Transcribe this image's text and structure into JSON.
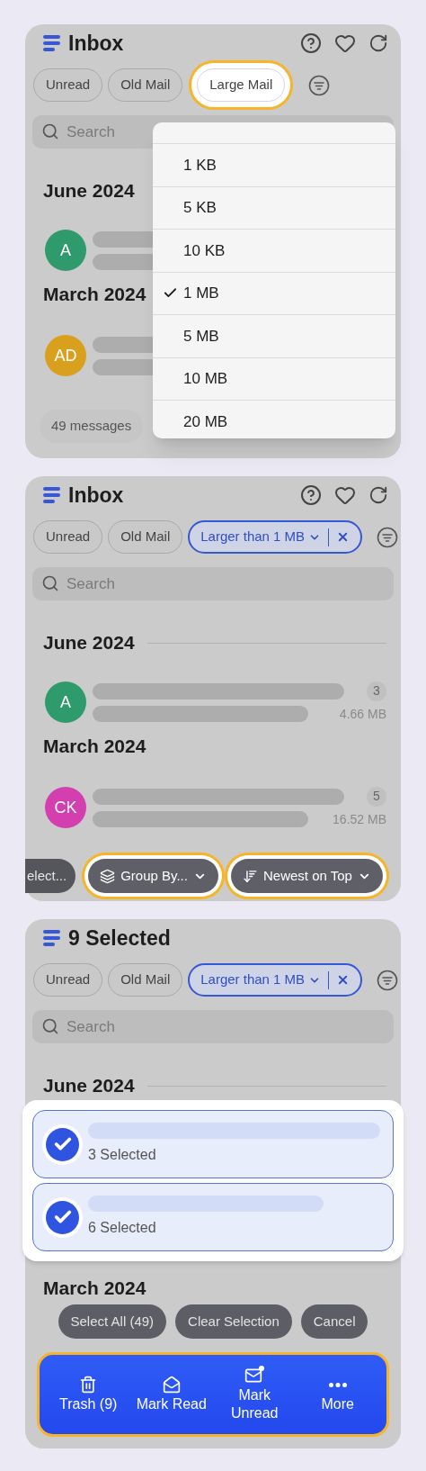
{
  "panels": [
    {
      "title": "Inbox",
      "show_actions": true,
      "filters": [
        {
          "label": "Unread",
          "kind": "chip",
          "active": false,
          "highlighted": false
        },
        {
          "label": "Old Mail",
          "kind": "chip",
          "active": false,
          "highlighted": false
        },
        {
          "label": "Large Mail",
          "kind": "chip",
          "active": false,
          "highlighted": true
        }
      ],
      "search": {
        "placeholder": "Search"
      },
      "sections": [
        {
          "heading": "June 2024",
          "rows": [
            {
              "kind": "message",
              "initials": "A",
              "color": "#2f9a6c"
            }
          ]
        },
        {
          "heading": "March 2024",
          "rows": [
            {
              "kind": "message",
              "initials": "AD",
              "color": "#d9a01e"
            }
          ]
        }
      ],
      "bottom_bar": [
        {
          "label": "49 messages",
          "kind": "count",
          "highlighted": false
        }
      ],
      "dropdown": {
        "items": [
          {
            "label": "1 KB",
            "selected": false
          },
          {
            "label": "5 KB",
            "selected": false
          },
          {
            "label": "10 KB",
            "selected": false
          },
          {
            "label": "1 MB",
            "selected": true
          },
          {
            "label": "5 MB",
            "selected": false
          },
          {
            "label": "10 MB",
            "selected": false
          },
          {
            "label": "20 MB",
            "selected": false
          }
        ]
      }
    },
    {
      "title": "Inbox",
      "show_actions": true,
      "filters": [
        {
          "label": "Unread",
          "kind": "chip",
          "active": false,
          "highlighted": false
        },
        {
          "label": "Old Mail",
          "kind": "chip",
          "active": false,
          "highlighted": false
        },
        {
          "label": "Larger than 1 MB",
          "kind": "dropdown",
          "active": true,
          "highlighted": false
        }
      ],
      "search": {
        "placeholder": "Search"
      },
      "sections": [
        {
          "heading": "June 2024",
          "divider": true,
          "rows": [
            {
              "kind": "message",
              "initials": "A",
              "color": "#2f9a6c",
              "count": "3",
              "size": "4.66 MB"
            }
          ]
        },
        {
          "heading": "March 2024",
          "divider": false,
          "rows": [
            {
              "kind": "message",
              "initials": "CK",
              "color": "#d43fb0",
              "count": "5",
              "size": "16.52 MB"
            }
          ]
        }
      ],
      "bottom_bar": [
        {
          "label": "elect...",
          "kind": "cut",
          "highlighted": false
        },
        {
          "label": "Group By...",
          "kind": "group",
          "highlighted": true
        },
        {
          "label": "Newest on Top",
          "kind": "sort",
          "highlighted": true
        }
      ]
    },
    {
      "title": "9 Selected",
      "show_actions": false,
      "filters": [
        {
          "label": "Unread",
          "kind": "chip",
          "active": false,
          "highlighted": false
        },
        {
          "label": "Old Mail",
          "kind": "chip",
          "active": false,
          "highlighted": false
        },
        {
          "label": "Larger than 1 MB",
          "kind": "dropdown",
          "active": true,
          "highlighted": false
        }
      ],
      "search": {
        "placeholder": "Search"
      },
      "sections": [
        {
          "heading": "June 2024",
          "divider": true,
          "rows": [
            {
              "kind": "selected",
              "checked": true,
              "caption": "3 Selected"
            },
            {
              "kind": "selected",
              "checked": true,
              "caption": "6 Selected"
            }
          ]
        },
        {
          "heading": "March 2024",
          "divider": false
        }
      ],
      "bottom_bar": [
        {
          "label": "Select All (49)",
          "kind": "action",
          "highlighted": false
        },
        {
          "label": "Clear Selection",
          "kind": "action",
          "highlighted": false
        },
        {
          "label": "Cancel",
          "kind": "action",
          "highlighted": false
        }
      ],
      "action_bar": {
        "highlighted": true,
        "items": [
          {
            "label": "Trash (9)",
            "kind": "trash"
          },
          {
            "label": "Mark Read",
            "kind": "read"
          },
          {
            "label": "Mark Unread",
            "kind": "unread"
          },
          {
            "label": "More",
            "kind": "more"
          }
        ]
      }
    }
  ]
}
